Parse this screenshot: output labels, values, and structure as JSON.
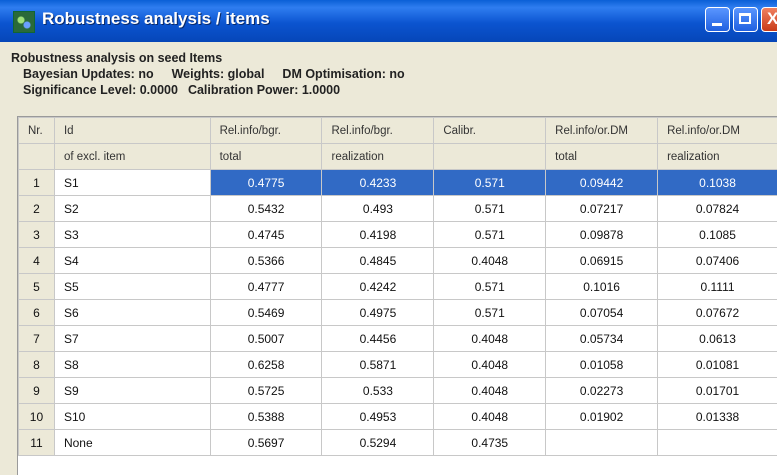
{
  "window": {
    "title": "Robustness analysis / items",
    "controls": {
      "minimize": "minimize",
      "maximize": "maximize",
      "close": "close"
    }
  },
  "info": {
    "line1": "Robustness analysis on seed Items",
    "bayesian": "Bayesian Updates: no",
    "weights": "Weights: global",
    "dm_opt": "DM Optimisation: no",
    "significance": "Significance Level:  0.0000",
    "calibration": "Calibration Power:  1.0000"
  },
  "table": {
    "headers1": [
      "Nr.",
      "Id",
      "Rel.info/bgr.",
      "Rel.info/bgr.",
      "Calibr.",
      "Rel.info/or.DM",
      "Rel.info/or.DM"
    ],
    "headers2": [
      "",
      "of excl. item",
      "total",
      "realization",
      "",
      "total",
      "realization"
    ],
    "rows": [
      [
        "1",
        "S1",
        "0.4775",
        "0.4233",
        "0.571",
        "0.09442",
        "0.1038"
      ],
      [
        "2",
        "S2",
        "0.5432",
        "0.493",
        "0.571",
        "0.07217",
        "0.07824"
      ],
      [
        "3",
        "S3",
        "0.4745",
        "0.4198",
        "0.571",
        "0.09878",
        "0.1085"
      ],
      [
        "4",
        "S4",
        "0.5366",
        "0.4845",
        "0.4048",
        "0.06915",
        "0.07406"
      ],
      [
        "5",
        "S5",
        "0.4777",
        "0.4242",
        "0.571",
        "0.1016",
        "0.1111"
      ],
      [
        "6",
        "S6",
        "0.5469",
        "0.4975",
        "0.571",
        "0.07054",
        "0.07672"
      ],
      [
        "7",
        "S7",
        "0.5007",
        "0.4456",
        "0.4048",
        "0.05734",
        "0.0613"
      ],
      [
        "8",
        "S8",
        "0.6258",
        "0.5871",
        "0.4048",
        "0.01058",
        "0.01081"
      ],
      [
        "9",
        "S9",
        "0.5725",
        "0.533",
        "0.4048",
        "0.02273",
        "0.01701"
      ],
      [
        "10",
        "S10",
        "0.5388",
        "0.4953",
        "0.4048",
        "0.01902",
        "0.01338"
      ],
      [
        "11",
        "None",
        "0.5697",
        "0.5294",
        "0.4735",
        "",
        ""
      ]
    ],
    "selected_row": "1",
    "colors": {
      "selection": "#316ac5",
      "titlebar": "#0b54d0",
      "header_bg": "#ece9d8"
    }
  }
}
